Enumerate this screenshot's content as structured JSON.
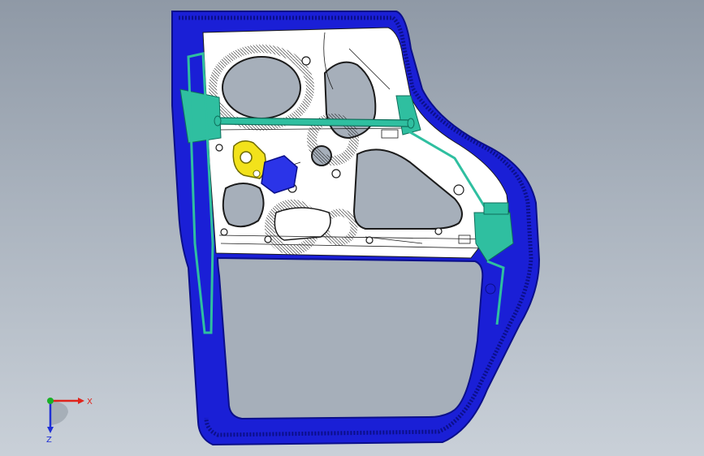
{
  "view": {
    "background_top": "#8f99a6",
    "background_bottom": "#c9d0d8"
  },
  "model": {
    "colors": {
      "frame": "#1a1fd6",
      "frame_dark": "#0b0f8a",
      "panel": "#ffffff",
      "linework": "#1b1b1b",
      "reinforcement": "#2fbfa0",
      "reinforcement_edge": "#0f6e5a",
      "bracket": "#f2e21b",
      "bracket_edge": "#6e6a00",
      "motor": "#2b34e8"
    }
  },
  "triad": {
    "x_label": "X",
    "z_label": "Z",
    "x_color": "#e0231b",
    "y_color": "#19b026",
    "z_color": "#1e2fd6"
  }
}
